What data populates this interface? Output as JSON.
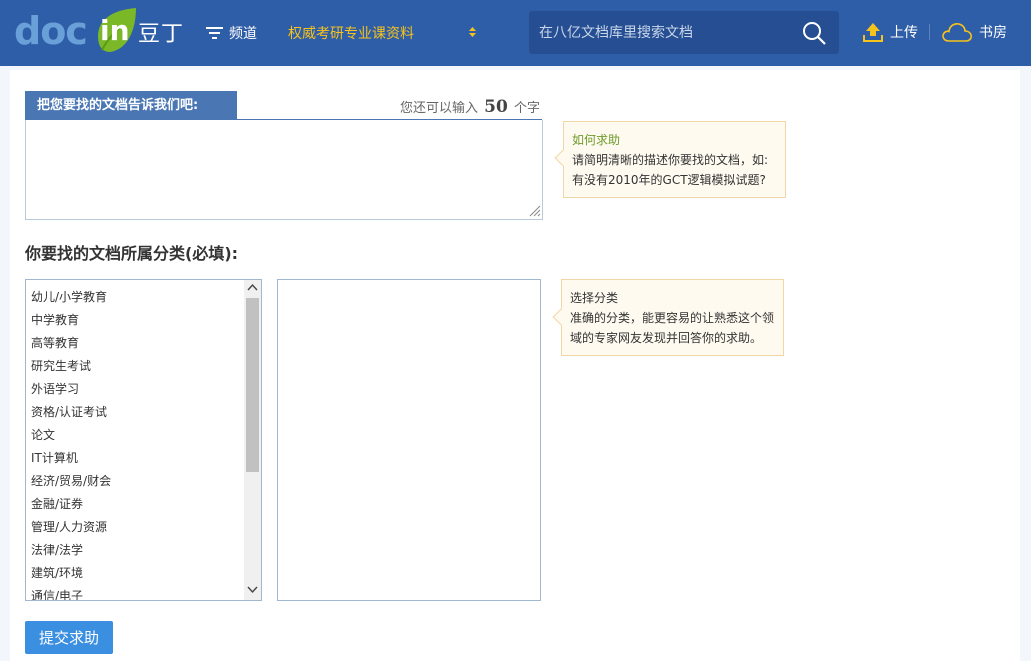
{
  "header": {
    "logo": {
      "latin_prefix": "doc",
      "latin_suffix": "in",
      "chinese": "豆丁"
    },
    "channel_label": "频道",
    "category_select_value": "权威考研专业课资料",
    "search_placeholder": "在八亿文档库里搜索文档",
    "upload_label": "上传",
    "study_label": "书房",
    "colors": {
      "bar": "#2f5ea8",
      "highlight": "#f6c21c"
    }
  },
  "request_form": {
    "tab_label": "把您要找的文档告诉我们吧:",
    "remaining_prefix": "您还可以输入",
    "remaining_count": "50",
    "remaining_suffix": "个字",
    "help_tip": {
      "title": "如何求助",
      "line1": "请简明清晰的描述你要找的文档，如:",
      "line2": "有没有2010年的GCT逻辑模拟试题?"
    }
  },
  "category": {
    "heading": "你要找的文档所属分类(必填):",
    "items": [
      "幼儿/小学教育",
      "中学教育",
      "高等教育",
      "研究生考试",
      "外语学习",
      "资格/认证考试",
      "论文",
      "IT计算机",
      "经济/贸易/财会",
      "金融/证券",
      "管理/人力资源",
      "法律/法学",
      "建筑/环境",
      "通信/电子"
    ],
    "tip": {
      "title": "选择分类",
      "line1": "准确的分类，能更容易的让熟悉这个领",
      "line2": "域的专家网友发现并回答你的求助。"
    }
  },
  "submit_label": "提交求助"
}
